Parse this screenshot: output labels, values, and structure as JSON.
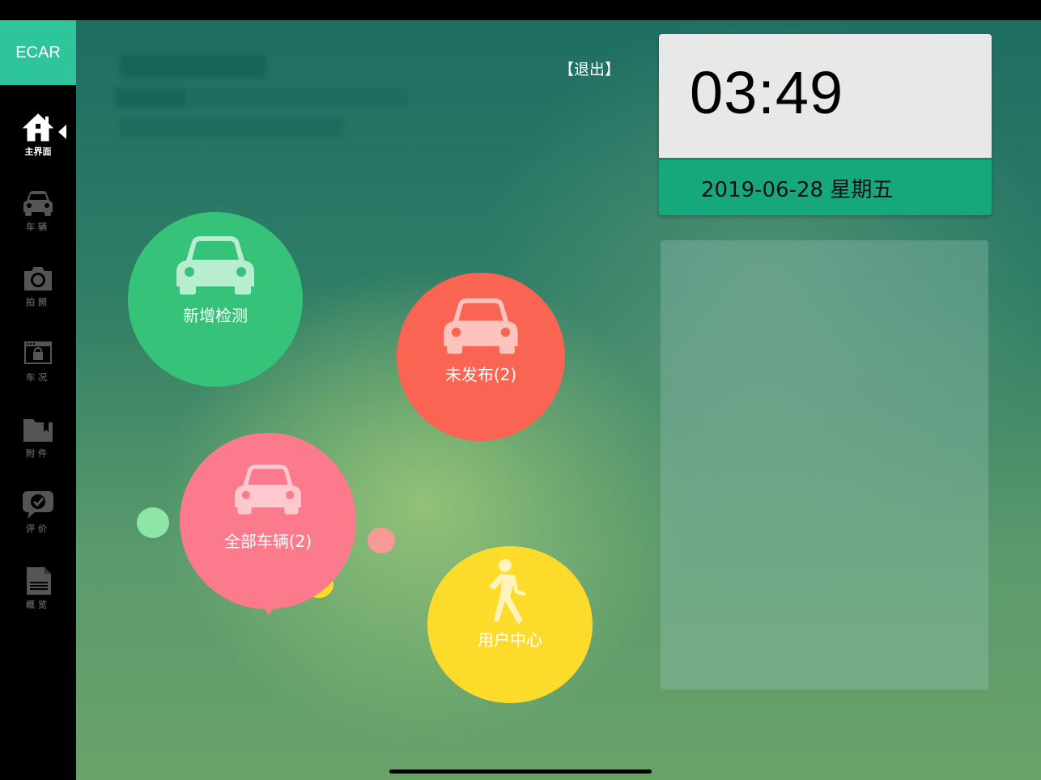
{
  "app": {
    "logo": "ECAR"
  },
  "sidebar": {
    "items": [
      {
        "label": "主界面",
        "icon": "home-icon",
        "active": true
      },
      {
        "label": "车辆",
        "icon": "car-icon"
      },
      {
        "label": "拍照",
        "icon": "camera-icon"
      },
      {
        "label": "车况",
        "icon": "car-condition-icon"
      },
      {
        "label": "附件",
        "icon": "attachment-folder-icon"
      },
      {
        "label": "评价",
        "icon": "review-chat-icon"
      },
      {
        "label": "概览",
        "icon": "overview-document-icon"
      }
    ]
  },
  "header": {
    "logout_label": "【退出】"
  },
  "clock": {
    "time": "03:49",
    "date": "2019-06-28 星期五"
  },
  "actions": {
    "new_inspection": {
      "label": "新增检测",
      "icon": "car-icon",
      "color": "#37c27a"
    },
    "unpublished": {
      "label": "未发布(2)",
      "icon": "car-icon",
      "color": "#fa6452"
    },
    "all_vehicles": {
      "label": "全部车辆(2)",
      "icon": "car-icon",
      "color": "#fb7a8b"
    },
    "user_center": {
      "label": "用户中心",
      "icon": "walking-person-icon",
      "color": "#fddb2a"
    }
  },
  "colors": {
    "accent": "#2fc59a",
    "date_bar": "#17a77c"
  }
}
